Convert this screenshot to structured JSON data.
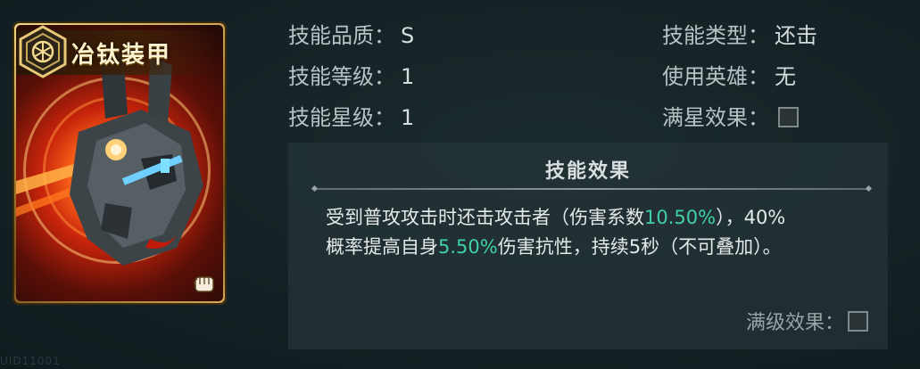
{
  "card": {
    "name": "冶钛装甲"
  },
  "info": {
    "quality_label": "技能品质：",
    "quality_value": "S",
    "type_label": "技能类型：",
    "type_value": "还击",
    "level_label": "技能等级：",
    "level_value": "1",
    "hero_label": "使用英雄：",
    "hero_value": "无",
    "star_label": "技能星级：",
    "star_value": "1",
    "fullstar_label": "满星效果："
  },
  "effect": {
    "title": "技能效果",
    "line1_a": "受到普攻攻击时还击攻击者（伤害系数",
    "line1_hl": "10.50%",
    "line1_b": "），40%",
    "line2_a": "概率提高自身",
    "line2_hl": "5.50%",
    "line2_b": "伤害抗性，持续5秒（不可叠加）。",
    "max_level_label": "满级效果："
  },
  "footer": {
    "id_text": "UID11001"
  },
  "colors": {
    "highlight": "#3fd1a4",
    "card_gold": "#d6ae57"
  },
  "icons": [
    "hexagon-badge-icon",
    "fist-icon"
  ]
}
